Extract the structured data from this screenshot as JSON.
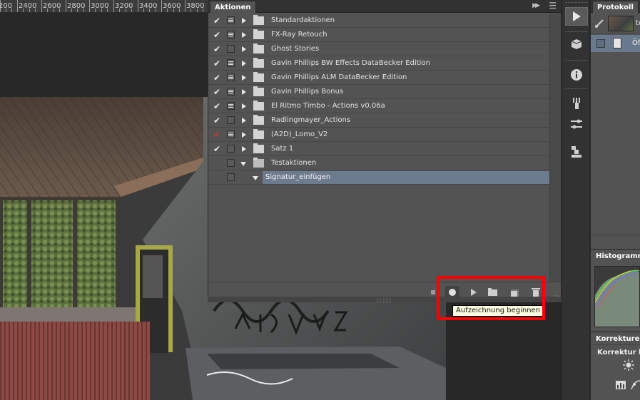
{
  "ruler": {
    "ticks": [
      "200",
      "2400",
      "2600",
      "2800",
      "3000",
      "3200",
      "3400",
      "3600",
      "3800"
    ]
  },
  "actions_panel": {
    "tab": "Aktionen",
    "items": [
      {
        "name": "Standardaktionen",
        "check": "on",
        "modal": true,
        "kind": "set"
      },
      {
        "name": "FX-Ray Retouch",
        "check": "on",
        "modal": true,
        "kind": "set"
      },
      {
        "name": "Ghost Stories",
        "check": "on",
        "modal": false,
        "kind": "set"
      },
      {
        "name": "Gavin Phillips BW Effects DataBecker Edition",
        "check": "on",
        "modal": true,
        "kind": "set"
      },
      {
        "name": "Gavin Phillips ALM DataBecker Edition",
        "check": "on",
        "modal": true,
        "kind": "set"
      },
      {
        "name": "Gavin Phillips  Bonus",
        "check": "on",
        "modal": true,
        "kind": "set"
      },
      {
        "name": "El Ritmo Timbo - Actions v0.06a",
        "check": "on",
        "modal": true,
        "kind": "set"
      },
      {
        "name": "Radlingmayer_Actions",
        "check": "on",
        "modal": false,
        "kind": "set"
      },
      {
        "name": "(A2D)_Lomo_V2",
        "check": "red",
        "modal": true,
        "kind": "set"
      },
      {
        "name": "Satz 1",
        "check": "on",
        "modal": false,
        "kind": "set"
      },
      {
        "name": "Testaktionen",
        "check": "off",
        "modal": false,
        "kind": "set-open"
      },
      {
        "name": "Signatur_einfügen",
        "check": "off",
        "modal": false,
        "kind": "action-selected"
      }
    ],
    "toolbar": {
      "stop": "stop-icon",
      "record": "record-icon",
      "play": "play-icon",
      "new_set": "folder-icon",
      "new_action": "new-action-icon",
      "delete": "trash-icon"
    },
    "tooltip": "Aufzeichnung beginnen"
  },
  "dock": {
    "icons": [
      "actions-play-icon",
      "3d-cube-icon",
      "info-icon",
      "brush-presets-icon",
      "tool-presets-icon",
      "clone-source-icon"
    ]
  },
  "right_column": {
    "protocol_tab": "Protokoll",
    "protocol_snapshot_name": "te",
    "protocol_step": "Öf",
    "histogram_tab": "Histogramm",
    "corrections_tab": "Korrekturen",
    "corrections_title": "Korrektur hi"
  },
  "colors": {
    "panel_bg": "#535353",
    "header_bg": "#323232",
    "selection": "#6c7b8e",
    "highlight": "#ff0000",
    "tooltip_bg": "#ffffe1",
    "check_red": "#d83030"
  }
}
